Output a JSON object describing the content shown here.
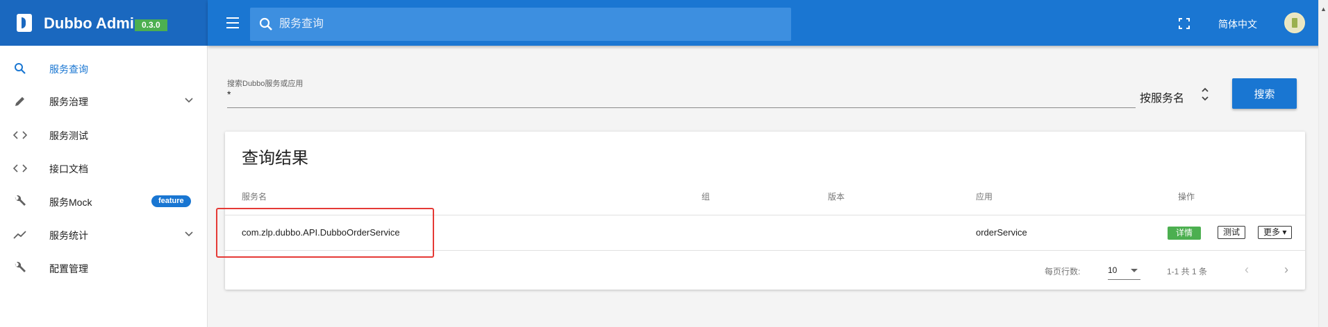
{
  "brand": {
    "title": "Dubbo Admin",
    "version": "0.3.0"
  },
  "sidebar": {
    "items": [
      {
        "label": "服务查询",
        "icon": "search-icon",
        "active": true
      },
      {
        "label": "服务治理",
        "icon": "pencil-icon",
        "expandable": true
      },
      {
        "label": "服务测试",
        "icon": "code-icon"
      },
      {
        "label": "接口文档",
        "icon": "code-icon"
      },
      {
        "label": "服务Mock",
        "icon": "wrench-icon",
        "badge": "feature"
      },
      {
        "label": "服务统计",
        "icon": "trending-icon",
        "expandable": true
      },
      {
        "label": "配置管理",
        "icon": "wrench-icon"
      }
    ]
  },
  "topbar": {
    "search_placeholder": "服务查询",
    "language": "简体中文"
  },
  "search": {
    "label": "搜索Dubbo服务或应用",
    "value": "*",
    "type": "按服务名",
    "button": "搜索"
  },
  "results": {
    "title": "查询结果",
    "headers": [
      "服务名",
      "组",
      "版本",
      "应用",
      "操作"
    ],
    "rows": [
      {
        "service": "com.zlp.dubbo.API.DubboOrderService",
        "group": "",
        "version": "",
        "application": "orderService",
        "actions": {
          "detail": "详情",
          "test": "测试",
          "more": "更多"
        }
      }
    ],
    "pagination": {
      "rows_per_page_label": "每页行数:",
      "rows_per_page": "10",
      "page_info": "1-1 共 1 条"
    }
  },
  "colors": {
    "brand": "#1a68bf",
    "topbar": "#1a76d2",
    "accent": "#1976d2",
    "success": "#4caf50",
    "highlight": "#e53935"
  }
}
